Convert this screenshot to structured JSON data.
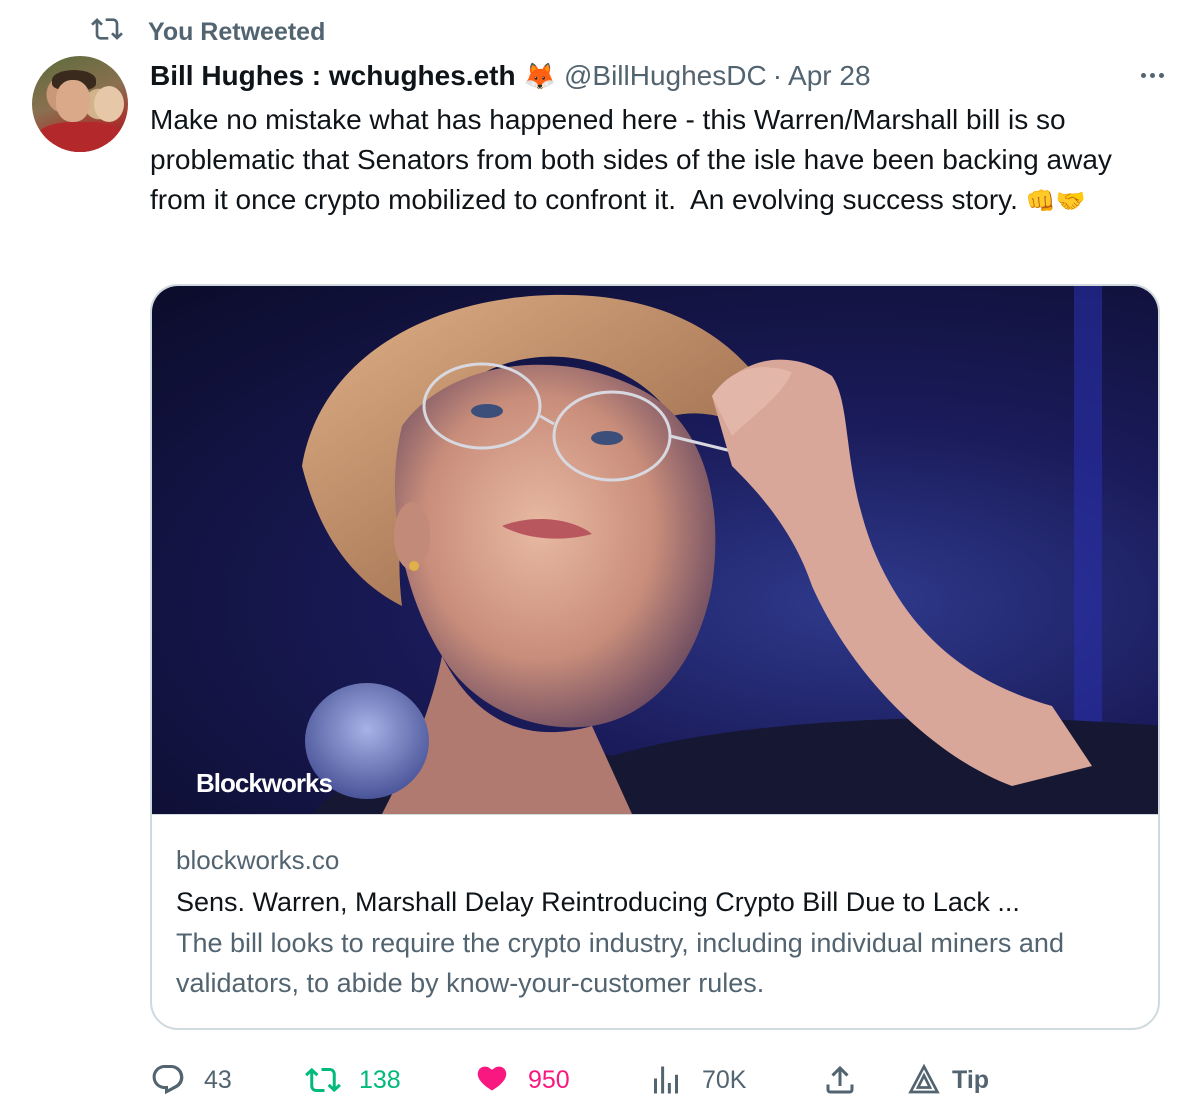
{
  "retweet_banner": {
    "label": "You Retweeted",
    "icon": "retweet-icon"
  },
  "tweet": {
    "author_name": "Bill Hughes : wchughes.eth",
    "author_emoji": "🦊",
    "handle": "@BillHughesDC",
    "separator": "·",
    "date": "Apr 28",
    "text": "Make no mistake what has happened here - this Warren/Marshall bill is so problematic that Senators from both sides of the isle have been backing away from it once crypto mobilized to confront it.  An evolving success story. ",
    "text_emoji": "👊🤝"
  },
  "card": {
    "image_watermark": "Blockworks",
    "domain": "blockworks.co",
    "title": "Sens. Warren, Marshall Delay Reintroducing Crypto Bill Due to Lack ...",
    "description": "The bill looks to require the crypto industry, including individual miners and validators, to abide by know-your-customer rules."
  },
  "actions": {
    "replies": "43",
    "retweets": "138",
    "likes": "950",
    "views": "70K",
    "tip_label": "Tip"
  },
  "colors": {
    "text_primary": "#0f1419",
    "text_secondary": "#536471",
    "retweet_green": "#00ba7c",
    "like_pink": "#f91880",
    "border": "#cfd9de"
  }
}
